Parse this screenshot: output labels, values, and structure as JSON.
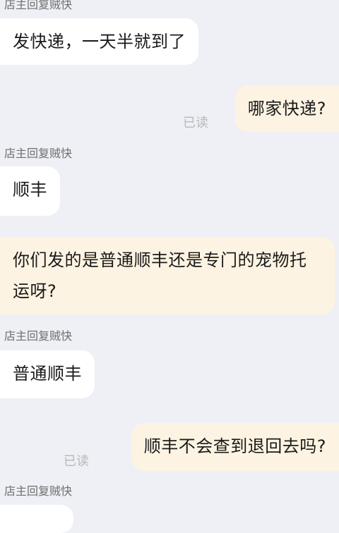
{
  "messages": [
    {
      "sender": "店主回复贼快"
    },
    {
      "text": "发快递，一天半就到了"
    },
    {
      "text": "哪家快递?",
      "status": "已读"
    },
    {
      "sender": "店主回复贼快"
    },
    {
      "text": "顺丰"
    },
    {
      "text": "你们发的是普通顺丰还是专门的宠物托运呀?"
    },
    {
      "sender": "店主回复贼快"
    },
    {
      "text": "普通顺丰"
    },
    {
      "text": "顺丰不会查到退回去吗?",
      "status": "已读"
    },
    {
      "sender": "店主回复贼快"
    }
  ],
  "colors": {
    "background": "#eef0f5",
    "incoming_bubble": "#ffffff",
    "outgoing_bubble": "#fdf3e2",
    "read_status": "#b8b8b8"
  }
}
